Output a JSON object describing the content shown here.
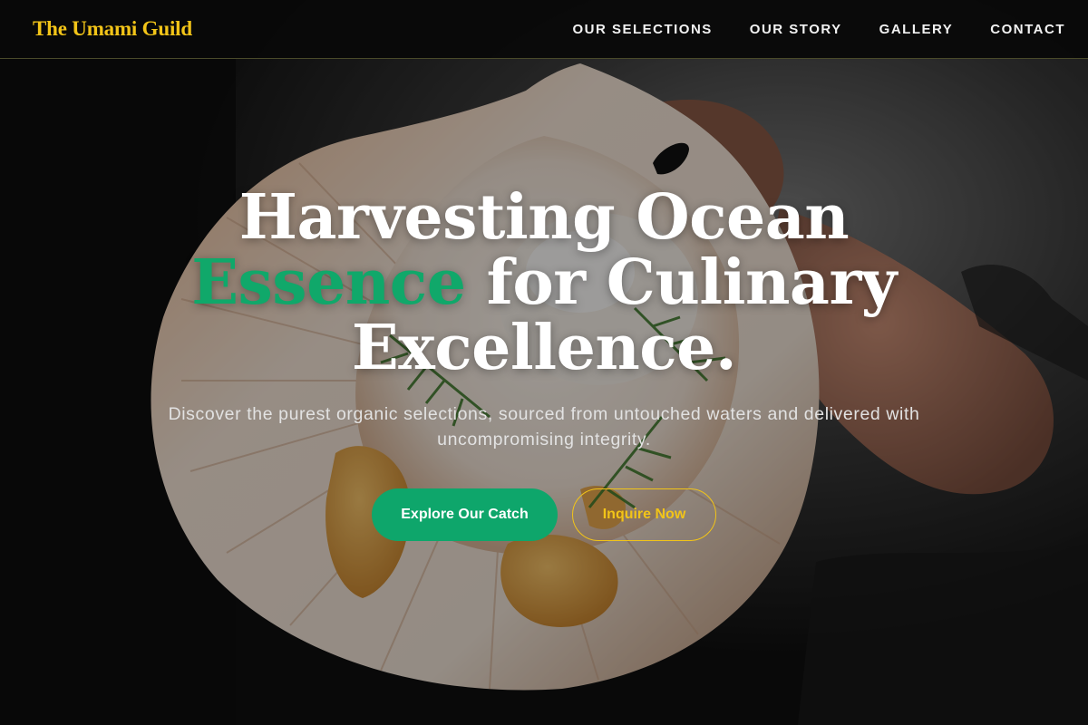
{
  "brand": {
    "name": "The Umami Guild"
  },
  "nav": {
    "items": [
      {
        "label": "OUR SELECTIONS"
      },
      {
        "label": "OUR STORY"
      },
      {
        "label": "GALLERY"
      },
      {
        "label": "CONTACT"
      }
    ]
  },
  "hero": {
    "title_line1": "Harvesting Ocean",
    "title_accent": "Essence",
    "title_line2_rest": " for Culinary",
    "title_line3": "Excellence.",
    "subtitle": "Discover the purest organic selections, sourced from untouched waters and delivered with uncompromising integrity.",
    "primary_button": "Explore Our Catch",
    "secondary_button": "Inquire Now",
    "background_image": "scallop-in-shell-photo"
  },
  "colors": {
    "brand_gold": "#f2c418",
    "accent_green": "#10a86a",
    "button_green": "#0ea66b",
    "nav_background": "#080808"
  }
}
